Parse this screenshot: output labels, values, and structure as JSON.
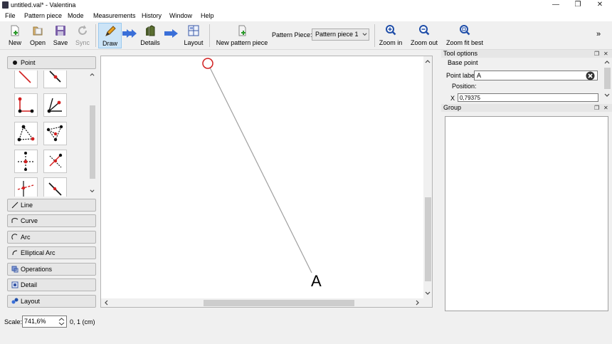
{
  "window": {
    "title": "untitled.val* - Valentina",
    "minimize_glyph": "—",
    "maximize_glyph": "❐",
    "close_glyph": "✕"
  },
  "menu": [
    "File",
    "Pattern piece",
    "Mode",
    "Measurements",
    "History",
    "Window",
    "Help"
  ],
  "toolbar": {
    "new_label": "New",
    "open_label": "Open",
    "save_label": "Save",
    "sync_label": "Sync",
    "draw_label": "Draw",
    "details_label": "Details",
    "layout_label": "Layout",
    "new_pattern_piece_label": "New pattern piece",
    "pattern_piece_caption": "Pattern Piece:",
    "pattern_piece_value": "Pattern piece 1",
    "zoom_in_label": "Zoom in",
    "zoom_out_label": "Zoom out",
    "zoom_fit_best_label": "Zoom fit best",
    "overflow_glyph": "»"
  },
  "tool_panel": {
    "point_label": "Point",
    "line_label": "Line",
    "curve_label": "Curve",
    "arc_label": "Arc",
    "elliptical_arc_label": "Elliptical Arc",
    "operations_label": "Operations",
    "detail_label": "Detail",
    "layout_label": "Layout"
  },
  "canvas": {
    "point_name": "A"
  },
  "tool_options": {
    "title": "Tool options",
    "section": "Base point",
    "point_label_caption": "Point label:",
    "point_label_value": "A",
    "position_caption": "Position:",
    "x_caption": "X",
    "x_value": "0,79375"
  },
  "group_dock": {
    "title": "Group"
  },
  "status": {
    "scale_caption": "Scale:",
    "scale_value": "741,6%",
    "coordinates": "0, 1 (cm)"
  },
  "colors": {
    "accent": "#cce4f7",
    "point_red": "#d12020",
    "line_gray": "#a0a0a0",
    "arrow_blue": "#3a6fd8"
  }
}
